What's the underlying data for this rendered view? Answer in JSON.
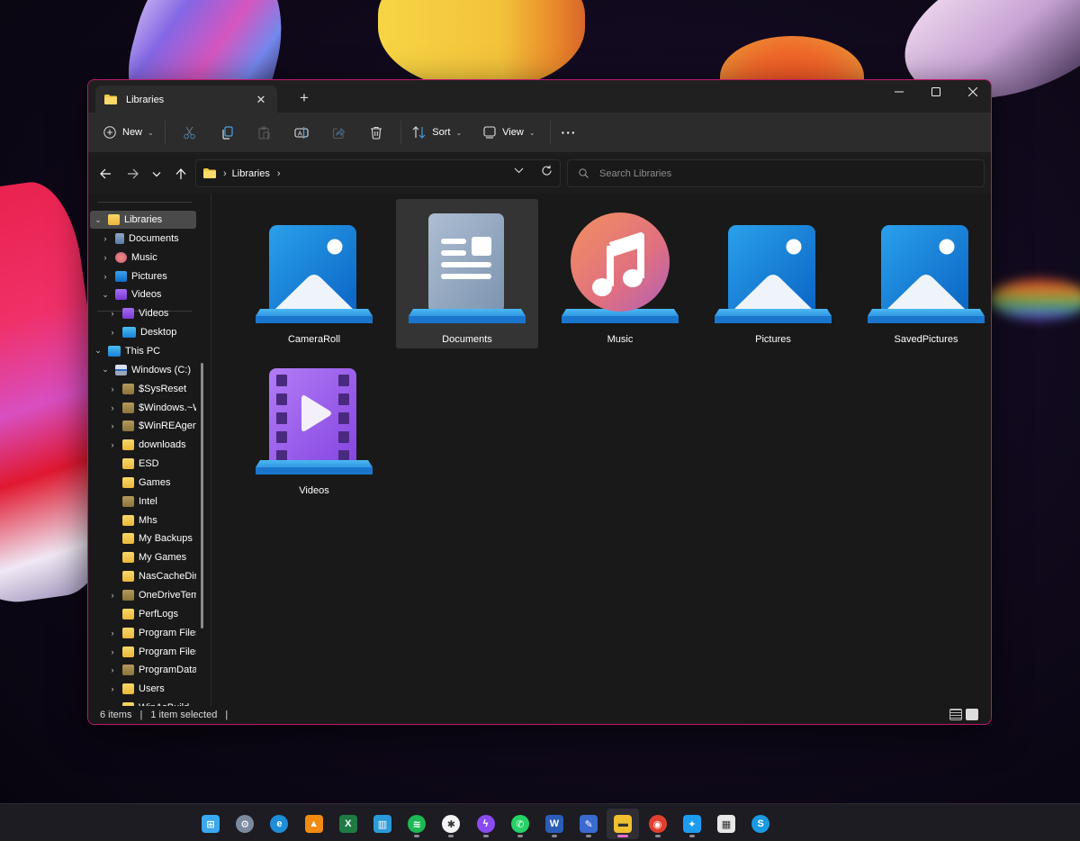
{
  "window": {
    "tab_title": "Libraries",
    "tab_close": "✕",
    "new_tab": "+",
    "controls": {
      "minimize": "—",
      "maximize": "☐",
      "close": "✕"
    }
  },
  "toolbar": {
    "new_label": "New",
    "sort_label": "Sort",
    "view_label": "View",
    "more_label": "···",
    "icons": [
      "cut-icon",
      "copy-icon",
      "paste-icon",
      "rename-icon",
      "share-icon",
      "delete-icon"
    ]
  },
  "address": {
    "breadcrumbs": [
      "Libraries"
    ],
    "separator": "›"
  },
  "search": {
    "placeholder": "Search Libraries",
    "value": ""
  },
  "navpane": {
    "items": [
      {
        "label": "Libraries",
        "icon": "folder",
        "chevron": "⌄",
        "level": 0,
        "selected": true
      },
      {
        "label": "Documents",
        "icon": "doc",
        "chevron": "›",
        "level": 1
      },
      {
        "label": "Music",
        "icon": "music",
        "chevron": "›",
        "level": 1
      },
      {
        "label": "Pictures",
        "icon": "pic",
        "chevron": "›",
        "level": 1
      },
      {
        "label": "Videos",
        "icon": "vid",
        "chevron": "⌄",
        "level": 1
      },
      {
        "label": "Videos",
        "icon": "vid",
        "chevron": "›",
        "level": 2
      },
      {
        "label": "Desktop",
        "icon": "desk",
        "chevron": "›",
        "level": 2
      },
      {
        "label": "This PC",
        "icon": "pc",
        "chevron": "⌄",
        "level": 0
      },
      {
        "label": "Windows (C:)",
        "icon": "drive",
        "chevron": "⌄",
        "level": 1
      },
      {
        "label": "$SysReset",
        "icon": "folder-dim",
        "chevron": "›",
        "level": 2
      },
      {
        "label": "$Windows.~W",
        "icon": "folder-dim",
        "chevron": "›",
        "level": 2
      },
      {
        "label": "$WinREAgent",
        "icon": "folder-dim",
        "chevron": "›",
        "level": 2
      },
      {
        "label": "downloads",
        "icon": "folder",
        "chevron": "›",
        "level": 2
      },
      {
        "label": "ESD",
        "icon": "folder",
        "chevron": "",
        "level": 2
      },
      {
        "label": "Games",
        "icon": "folder",
        "chevron": "",
        "level": 2
      },
      {
        "label": "Intel",
        "icon": "folder-dim",
        "chevron": "",
        "level": 2
      },
      {
        "label": "Mhs",
        "icon": "folder",
        "chevron": "",
        "level": 2
      },
      {
        "label": "My Backups",
        "icon": "folder",
        "chevron": "",
        "level": 2
      },
      {
        "label": "My Games",
        "icon": "folder",
        "chevron": "",
        "level": 2
      },
      {
        "label": "NasCacheDirec",
        "icon": "folder",
        "chevron": "",
        "level": 2
      },
      {
        "label": "OneDriveTemp",
        "icon": "folder-dim",
        "chevron": "›",
        "level": 2
      },
      {
        "label": "PerfLogs",
        "icon": "folder",
        "chevron": "",
        "level": 2
      },
      {
        "label": "Program Files",
        "icon": "folder",
        "chevron": "›",
        "level": 2
      },
      {
        "label": "Program Files (",
        "icon": "folder",
        "chevron": "›",
        "level": 2
      },
      {
        "label": "ProgramData",
        "icon": "folder-dim",
        "chevron": "›",
        "level": 2
      },
      {
        "label": "Users",
        "icon": "folder",
        "chevron": "›",
        "level": 2
      },
      {
        "label": "WinAsBuild",
        "icon": "folder",
        "chevron": "›",
        "level": 2
      }
    ]
  },
  "libraries": [
    {
      "label": "CameraRoll",
      "icon": "picture-library-icon",
      "selected": false
    },
    {
      "label": "Documents",
      "icon": "documents-library-icon",
      "selected": true
    },
    {
      "label": "Music",
      "icon": "music-library-icon",
      "selected": false
    },
    {
      "label": "Pictures",
      "icon": "picture-library-icon",
      "selected": false
    },
    {
      "label": "SavedPictures",
      "icon": "picture-library-icon",
      "selected": false
    },
    {
      "label": "Videos",
      "icon": "videos-library-icon",
      "selected": false
    }
  ],
  "status": {
    "item_count": "6 items",
    "selection": "1 item selected",
    "separator": "|"
  },
  "taskbar": {
    "apps": [
      {
        "name": "start",
        "glyph": "⊞",
        "color": "#3aa8f0",
        "running": false
      },
      {
        "name": "settings",
        "glyph": "⚙",
        "color": "#7a8aa0",
        "running": false
      },
      {
        "name": "edge",
        "glyph": "e",
        "color": "#1e8ed8",
        "running": false
      },
      {
        "name": "vlc",
        "glyph": "▲",
        "color": "#f08a10",
        "running": false
      },
      {
        "name": "excel",
        "glyph": "X",
        "color": "#1f7a44",
        "running": false
      },
      {
        "name": "azure-data-studio",
        "glyph": "▥",
        "color": "#2a9ad8",
        "running": false
      },
      {
        "name": "spotify",
        "glyph": "≋",
        "color": "#1db954",
        "running": true
      },
      {
        "name": "slack",
        "glyph": "✱",
        "color": "#f4f4f4",
        "running": true
      },
      {
        "name": "messenger",
        "glyph": "ϟ",
        "color": "#8a4cf0",
        "running": true
      },
      {
        "name": "whatsapp",
        "glyph": "✆",
        "color": "#25d366",
        "running": true
      },
      {
        "name": "word",
        "glyph": "W",
        "color": "#2b5cb8",
        "running": true
      },
      {
        "name": "snip",
        "glyph": "✎",
        "color": "#3a6ad0",
        "running": true
      },
      {
        "name": "file-explorer",
        "glyph": "▬",
        "color": "#f0c030",
        "running": true,
        "active": true
      },
      {
        "name": "chrome",
        "glyph": "◉",
        "color": "#e04030",
        "running": true
      },
      {
        "name": "twitter",
        "glyph": "✦",
        "color": "#1d9bf0",
        "running": true
      },
      {
        "name": "microsoft-store",
        "glyph": "▦",
        "color": "#e8e8e8",
        "running": false
      },
      {
        "name": "skype",
        "glyph": "S",
        "color": "#1a9ae0",
        "running": false
      }
    ]
  }
}
